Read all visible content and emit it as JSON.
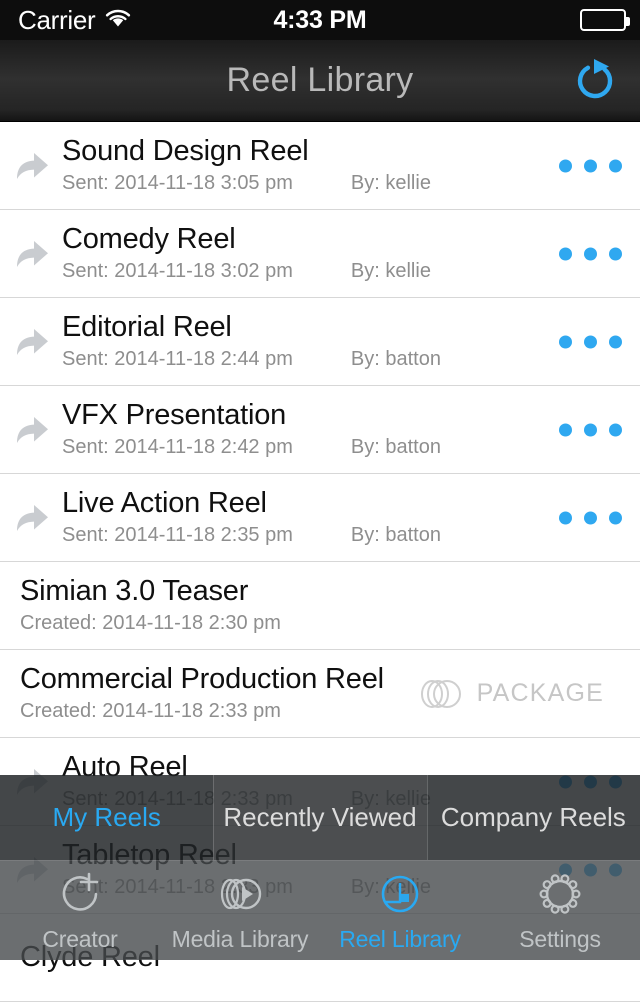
{
  "status_bar": {
    "carrier": "Carrier",
    "wifi_icon": "wifi-icon",
    "time": "4:33 PM",
    "battery_icon": "battery-full-icon"
  },
  "nav": {
    "title": "Reel Library",
    "refresh_icon": "refresh-icon",
    "accent_color": "#2fa8f0"
  },
  "list": {
    "rows": [
      {
        "title": "Sound Design Reel",
        "meta_primary": "Sent: 2014-11-18 3:05 pm",
        "meta_by": "By: kellie",
        "has_share_icon": true,
        "has_menu": true,
        "badge": null
      },
      {
        "title": "Comedy Reel",
        "meta_primary": "Sent: 2014-11-18 3:02 pm",
        "meta_by": "By: kellie",
        "has_share_icon": true,
        "has_menu": true,
        "badge": null
      },
      {
        "title": "Editorial Reel",
        "meta_primary": "Sent: 2014-11-18 2:44 pm",
        "meta_by": "By: batton",
        "has_share_icon": true,
        "has_menu": true,
        "badge": null
      },
      {
        "title": "VFX Presentation",
        "meta_primary": "Sent: 2014-11-18 2:42 pm",
        "meta_by": "By: batton",
        "has_share_icon": true,
        "has_menu": true,
        "badge": null
      },
      {
        "title": "Live Action Reel",
        "meta_primary": "Sent: 2014-11-18 2:35 pm",
        "meta_by": "By: batton",
        "has_share_icon": true,
        "has_menu": true,
        "badge": null
      },
      {
        "title": "Simian 3.0 Teaser",
        "meta_primary": "Created: 2014-11-18 2:30 pm",
        "meta_by": "",
        "has_share_icon": false,
        "has_menu": false,
        "badge": null
      },
      {
        "title": "Commercial Production Reel",
        "meta_primary": "Created: 2014-11-18 2:33 pm",
        "meta_by": "",
        "has_share_icon": false,
        "has_menu": false,
        "badge": "PACKAGE"
      },
      {
        "title": "Auto Reel",
        "meta_primary": "Sent: 2014-11-18 2:33 pm",
        "meta_by": "By: kellie",
        "has_share_icon": true,
        "has_menu": true,
        "badge": null
      },
      {
        "title": "Tabletop Reel",
        "meta_primary": "Sent: 2014-11-18 2:33 pm",
        "meta_by": "By: kellie",
        "has_share_icon": true,
        "has_menu": true,
        "badge": null
      },
      {
        "title": "Clyde Reel",
        "meta_primary": "",
        "meta_by": "",
        "has_share_icon": false,
        "has_menu": false,
        "badge": null
      }
    ]
  },
  "segmented": {
    "items": [
      {
        "label": "My Reels",
        "active": true
      },
      {
        "label": "Recently Viewed",
        "active": false
      },
      {
        "label": "Company Reels",
        "active": false
      }
    ]
  },
  "tabbar": {
    "items": [
      {
        "label": "Creator",
        "icon": "circle-plus-icon",
        "active": false
      },
      {
        "label": "Media Library",
        "icon": "stacked-discs-play-icon",
        "active": false
      },
      {
        "label": "Reel Library",
        "icon": "reel-circle-icon",
        "active": true
      },
      {
        "label": "Settings",
        "icon": "gear-icon",
        "active": false
      }
    ],
    "active_color": "#29a9f2"
  }
}
